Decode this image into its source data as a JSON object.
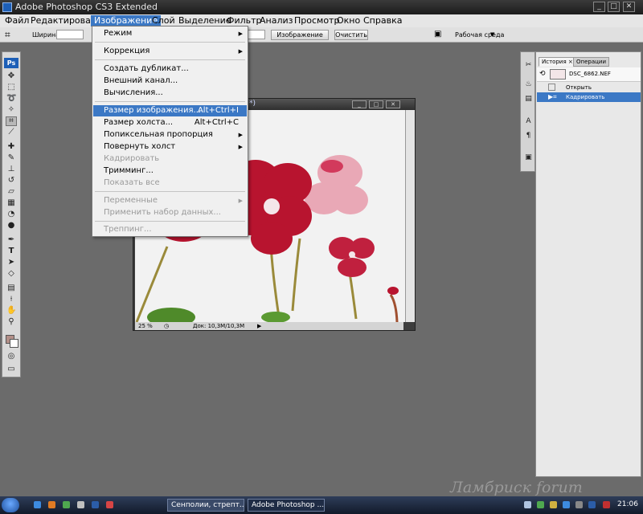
{
  "window": {
    "title": "Adobe Photoshop CS3 Extended"
  },
  "menubar": [
    "Файл",
    "Редактирование",
    "Изображение",
    "Слой",
    "Выделение",
    "Фильтр",
    "Анализ",
    "Просмотр",
    "Окно",
    "Справка"
  ],
  "options_bar": {
    "width_label": "Ширина:",
    "width_value": "",
    "front_image_button": "Изображение",
    "clear_button": "Очистить",
    "workspace_label": "Рабочая среда"
  },
  "image_menu": {
    "items": [
      {
        "label": "Режим",
        "submenu": true
      },
      {
        "label": "Коррекция",
        "submenu": true
      },
      {
        "label": "Создать дубликат..."
      },
      {
        "label": "Внешний канал..."
      },
      {
        "label": "Вычисления..."
      },
      {
        "label": "Размер изображения...",
        "shortcut": "Alt+Ctrl+I",
        "highlighted": true
      },
      {
        "label": "Размер холста...",
        "shortcut": "Alt+Ctrl+C"
      },
      {
        "label": "Попиксельная пропорция",
        "submenu": true
      },
      {
        "label": "Повернуть холст",
        "submenu": true
      },
      {
        "label": "Кадрировать",
        "disabled": true
      },
      {
        "label": "Тримминг..."
      },
      {
        "label": "Показать все",
        "disabled": true
      },
      {
        "label": "Переменные",
        "submenu": true,
        "disabled": true
      },
      {
        "label": "Применить набор данных...",
        "disabled": true
      },
      {
        "label": "Треппинг...",
        "disabled": true
      }
    ]
  },
  "document": {
    "title_fragment": "*)",
    "zoom": "25 %",
    "doc_size": "Док: 10,3M/10,3M"
  },
  "history_panel": {
    "tabs": [
      "История",
      "Операции"
    ],
    "tab_close": "×",
    "snapshot": "DSC_6862.NEF",
    "states": [
      {
        "label": "Открыть",
        "selected": false
      },
      {
        "label": "Кадрировать",
        "selected": true
      }
    ]
  },
  "taskbar": {
    "tasks": [
      {
        "label": "Сенполии, стрепт...",
        "active": false
      },
      {
        "label": "Adobe Photoshop ...",
        "active": true
      }
    ],
    "clock": "21:06"
  },
  "watermark": "Ламбриск forum",
  "colors": {
    "accent": "#3b78c5",
    "foreground_swatch": "#b38f88"
  },
  "icons": {
    "titlebar_buttons": [
      "minimize-icon",
      "maximize-icon",
      "close-icon"
    ],
    "toolbox": [
      "move-icon",
      "marquee-icon",
      "lasso-icon",
      "magic-wand-icon",
      "crop-icon",
      "slice-icon",
      "heal-icon",
      "brush-icon",
      "stamp-icon",
      "history-brush-icon",
      "eraser-icon",
      "gradient-icon",
      "blur-icon",
      "dodge-icon",
      "pen-icon",
      "type-icon",
      "path-select-icon",
      "shape-icon",
      "notes-icon",
      "eyedropper-icon",
      "hand-icon",
      "zoom-icon"
    ]
  }
}
